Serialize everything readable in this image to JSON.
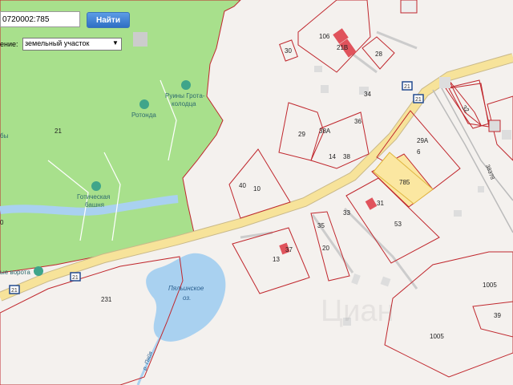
{
  "search": {
    "value": "0720002:785",
    "button_label": "Найти"
  },
  "filter": {
    "label": "ение:",
    "selected": "земельный участок"
  },
  "map_labels": {
    "poi_ruins": "Руины Грота-",
    "poi_ruins_2": "колодца",
    "poi_rotonda": "Ротонда",
    "poi_gothic": "Готическая",
    "poi_gothic_2": "башня",
    "poi_gate": "ые ворота",
    "poi_left": "бы",
    "lake": "Пяльинское",
    "lake_2": "оз.",
    "river": "р. Пяйя",
    "road_a": "21",
    "road_b": "21",
    "road_c": "21",
    "road_d": "21",
    "road_num": "38378",
    "watermark": "Циан"
  },
  "parcels": [
    "106",
    "21В",
    "28",
    "30",
    "29",
    "38А",
    "36",
    "34",
    "14",
    "38",
    "40",
    "10",
    "29А",
    "6",
    "785",
    "32",
    "31",
    "53",
    "33",
    "35",
    "37",
    "13",
    "20",
    "231",
    "1005",
    "1005",
    "39",
    "21",
    "0"
  ],
  "colors": {
    "park": "#a8e08c",
    "water": "#a9d1f0",
    "road": "#f7e39a",
    "selected": "#fbe7a1",
    "boundary": "#c0272d",
    "building": "#e0535c"
  }
}
